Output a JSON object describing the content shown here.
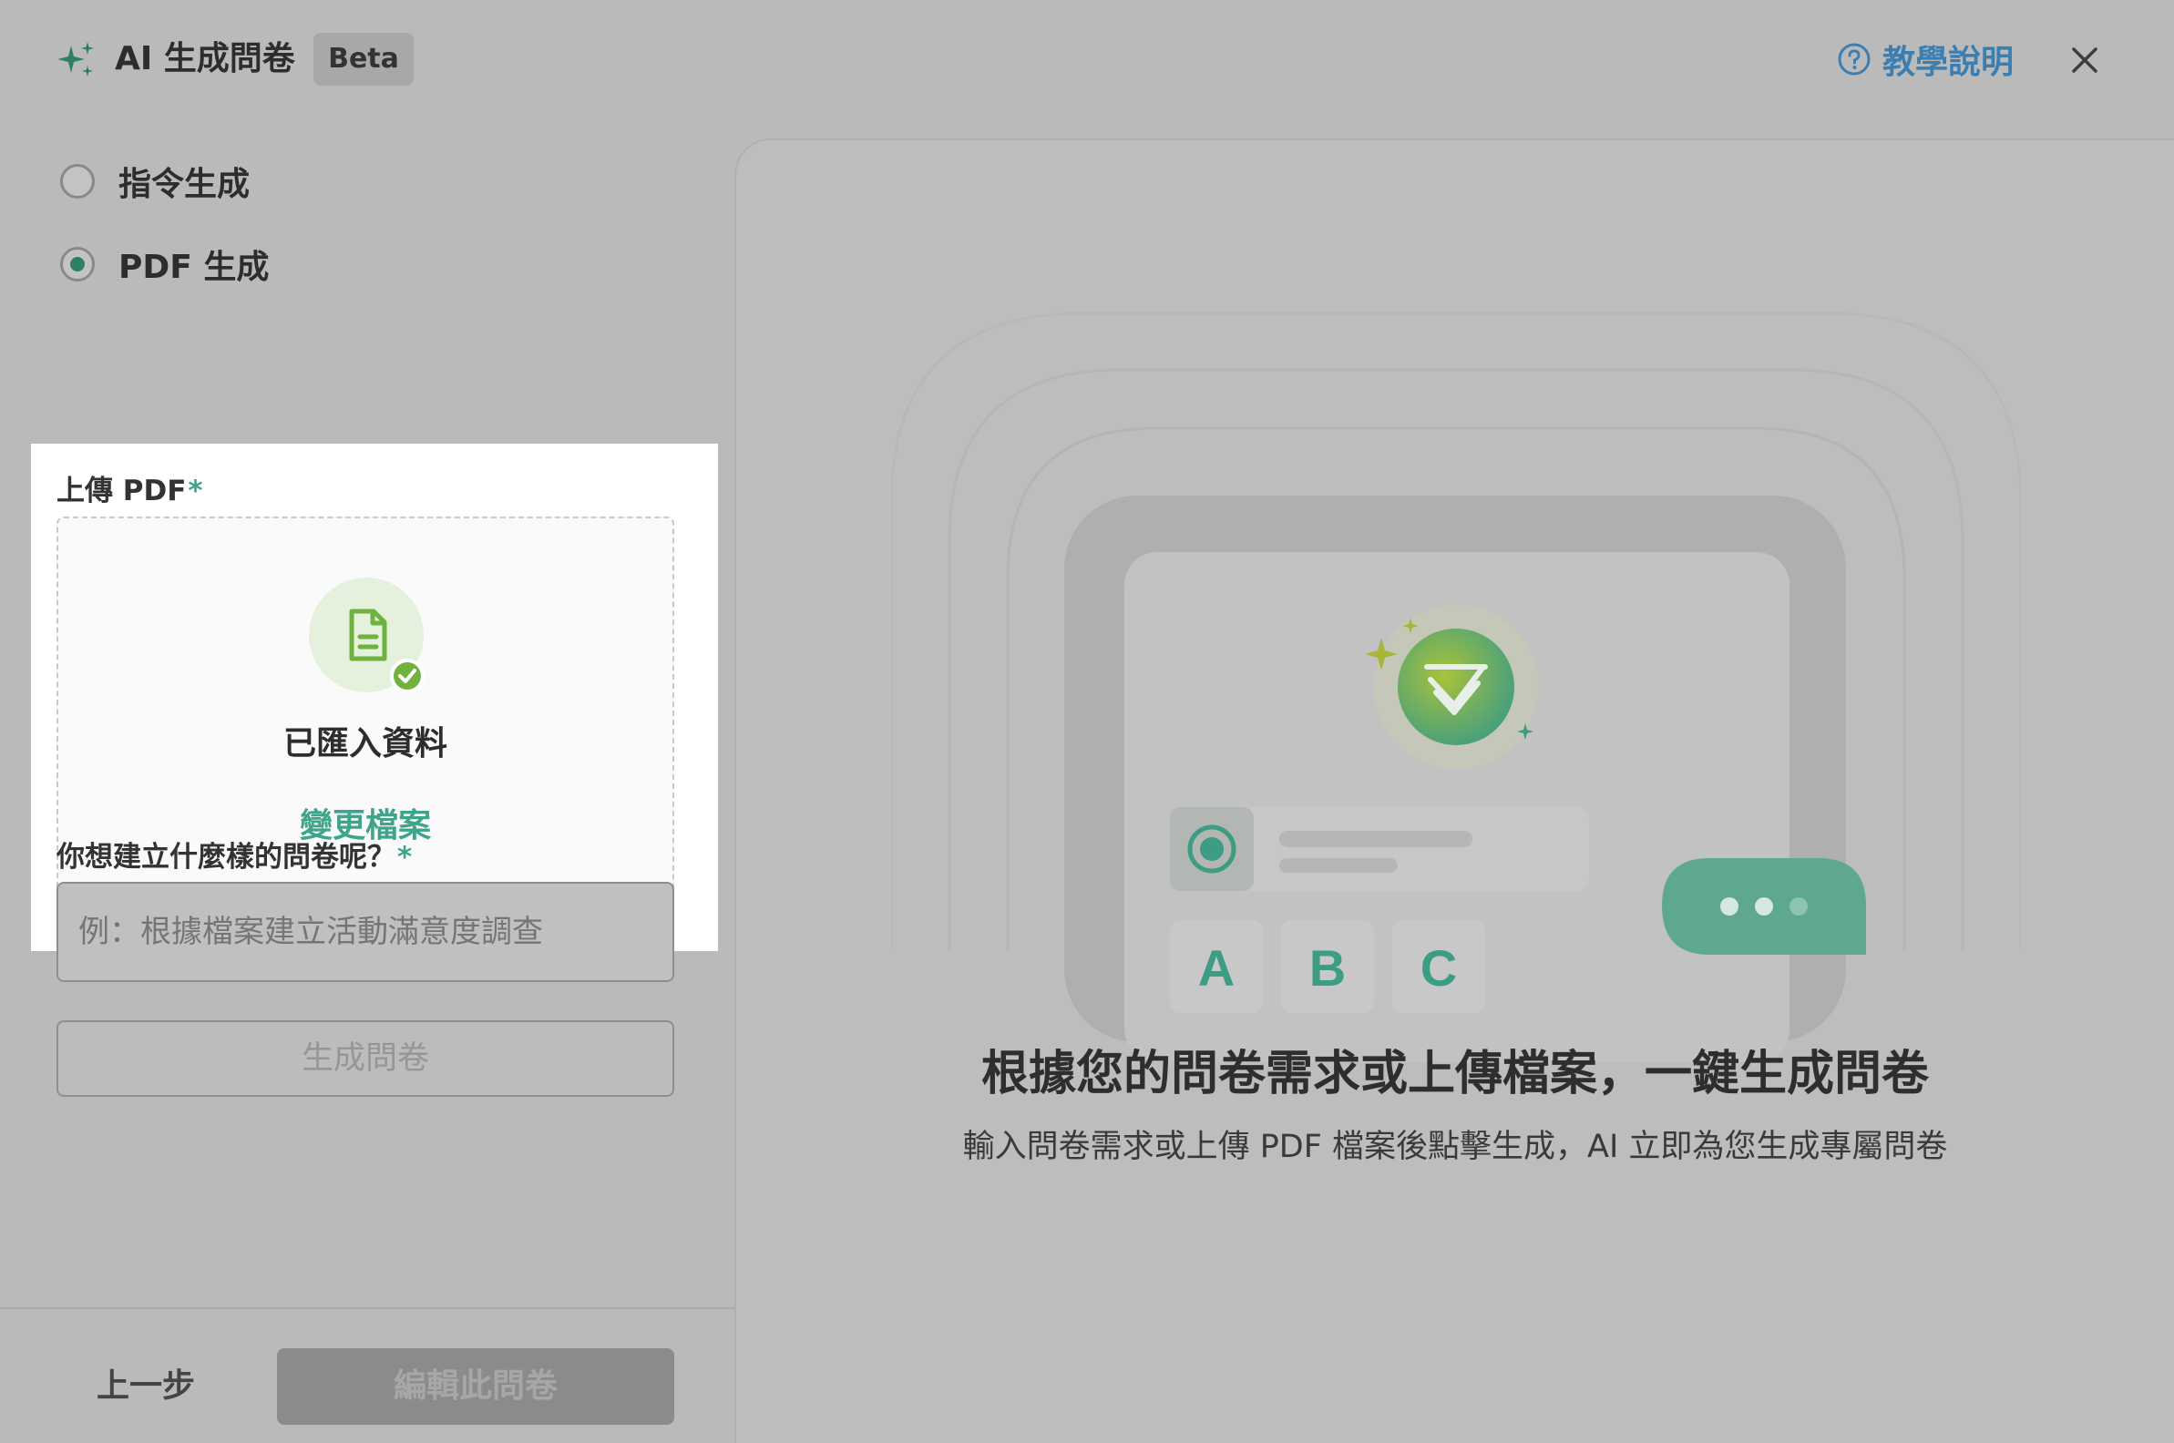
{
  "header": {
    "title": "AI 生成問卷",
    "badge": "Beta",
    "help_label": "教學說明",
    "icons": {
      "sparkle": "sparkle-icon",
      "help": "help-circle-icon",
      "close": "close-icon"
    },
    "accent_color": "#3a7fb0"
  },
  "mode_options": [
    {
      "label": "指令生成",
      "selected": false
    },
    {
      "label": "PDF 生成",
      "selected": true
    }
  ],
  "upload": {
    "label": "上傳 PDF",
    "required_mark": "*",
    "status": "已匯入資料",
    "change_label": "變更檔案",
    "icons": {
      "file": "file-document-icon",
      "check": "check-circle-icon"
    }
  },
  "prompt": {
    "label": "你想建立什麼樣的問卷呢？",
    "required_mark": "*",
    "placeholder": "例：根據檔案建立活動滿意度調查",
    "value": ""
  },
  "generate_label": "生成問卷",
  "footer": {
    "back_label": "上一步",
    "edit_label": "編輯此問卷"
  },
  "hero": {
    "title": "根據您的問卷需求或上傳檔案，一鍵生成問卷",
    "subtitle": "輸入問卷需求或上傳 PDF 檔案後點擊生成，AI 立即為您生成專屬問卷",
    "option_letters": [
      "A",
      "B",
      "C"
    ]
  },
  "colors": {
    "brand_green": "#3ea58a",
    "overlay_gray": "#bbbabb",
    "highlight_white": "#ffffff"
  }
}
